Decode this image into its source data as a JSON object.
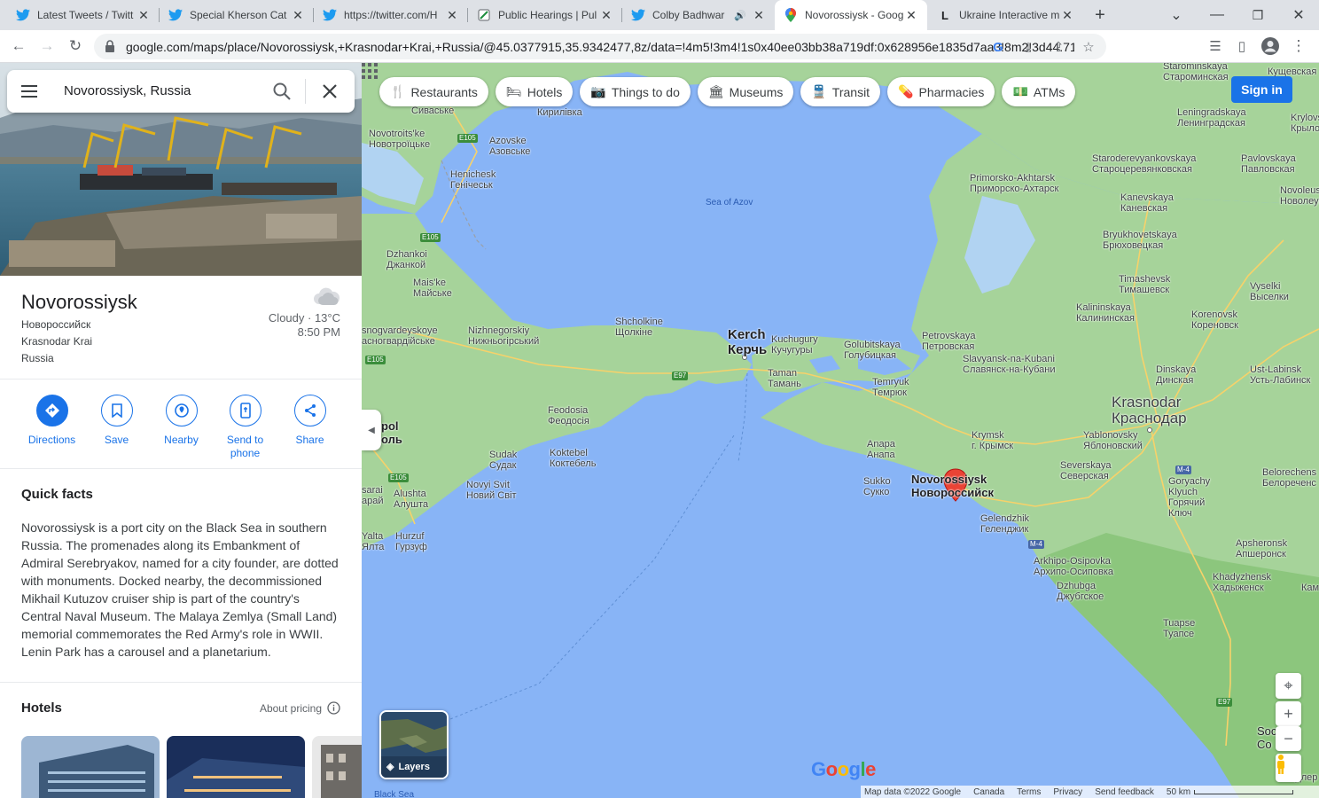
{
  "browser": {
    "tabs": [
      {
        "title": "Latest Tweets / Twitt",
        "icon": "twitter-icon"
      },
      {
        "title": "Special Kherson Cat",
        "icon": "twitter-icon"
      },
      {
        "title": "https://twitter.com/H",
        "icon": "twitter-icon"
      },
      {
        "title": "Public Hearings | Pul",
        "icon": "document-icon"
      },
      {
        "title": "Colby Badhwar",
        "icon": "twitter-icon"
      },
      {
        "title": "Novorossiysk - Goog",
        "icon": "maps-pin-icon"
      },
      {
        "title": "Ukraine Interactive m",
        "icon": "liveuamap-icon"
      }
    ],
    "url": "google.com/maps/place/Novorossiysk,+Krasnodar+Krai,+Russia/@45.0377915,35.9342477,8z/data=!4m5!3m4!1s0x40ee03bb38a719df:0x628956e1835d7aa3!8m2!3d44.718..."
  },
  "search": {
    "query": "Novorossiysk, Russia"
  },
  "place": {
    "name": "Novorossiysk",
    "local_name": "Новороссийск",
    "region": "Krasnodar Krai",
    "country": "Russia",
    "weather": "Cloudy · 13°C",
    "time": "8:50 PM"
  },
  "actions": [
    {
      "label": "Directions",
      "icon": "directions-icon"
    },
    {
      "label": "Save",
      "icon": "bookmark-icon"
    },
    {
      "label": "Nearby",
      "icon": "nearby-icon"
    },
    {
      "label": "Send to phone",
      "icon": "phone-icon"
    },
    {
      "label": "Share",
      "icon": "share-icon"
    }
  ],
  "quick_facts": {
    "heading": "Quick facts",
    "text": "Novorossiysk is a port city on the Black Sea in southern Russia. The promenades along its Embankment of Admiral Serebryakov, named for a city founder, are dotted with monuments. Docked nearby, the decommissioned Mikhail Kutuzov cruiser ship is part of the country's Central Naval Museum. The Malaya Zemlya (Small Land) memorial commemorates the Red Army's role in WWII. Lenin Park has a carousel and a planetarium."
  },
  "hotels": {
    "heading": "Hotels",
    "pricing_label": "About pricing"
  },
  "chips": [
    "Restaurants",
    "Hotels",
    "Things to do",
    "Museums",
    "Transit",
    "Pharmacies",
    "ATMs"
  ],
  "map": {
    "sign_in": "Sign in",
    "layers_label": "Layers",
    "logo": "Google",
    "footer": [
      "Map data ©2022 Google",
      "Canada",
      "Terms",
      "Privacy",
      "Send feedback",
      "50 km"
    ],
    "labels": {
      "sea_azov": "Sea of Azov",
      "black_sea": "Black Sea",
      "kerch": "Kerch",
      "kerch_ru": "Керчь",
      "krasnodar": "Krasnodar",
      "krasnodar_ru": "Краснодар",
      "novo": "Novorossiysk",
      "novo_ru": "Новороссийск",
      "sivaske": "Сиваське",
      "kyrylivka": "Кирилівка",
      "novotroitske": "Novotroits'ke",
      "novotroitske_ru": "Новотроїцьке",
      "azovske": "Azovske",
      "azovske_ru": "Азовське",
      "henichesk": "Henichesk",
      "henichesk_ru": "Генічеськ",
      "dzhankoi": "Dzhankoi",
      "dzhankoi_ru": "Джанкой",
      "maiske": "Mais'ke",
      "maiske_ru": "Майське",
      "snogvardeiskoe": "snogvardeyskoye",
      "snogvardeiskoe_ru": "асногвардійське",
      "nizhnegorsky": "Nizhnegorskiy",
      "nizhnegorsky_ru": "Нижньогірський",
      "shcholkine": "Shcholkine",
      "shcholkine_ru": "Щолкіне",
      "kuchugury": "Kuchugury",
      "kuchugury_ru": "Кучугуры",
      "taman": "Taman",
      "taman_ru": "Тамань",
      "golubitskaya": "Golubitskaya",
      "golubitskaya_ru": "Голубицкая",
      "temryuk": "Temryuk",
      "temryuk_ru": "Темрюк",
      "petrovskaya": "Petrovskaya",
      "petrovskaya_ru": "Петровская",
      "slavyansk": "Slavyansk-na-Kubani",
      "slavyansk_ru": "Славянск-на-Кубани",
      "feodosia": "Feodosia",
      "feodosia_ru": "Феодосія",
      "sudak": "Sudak",
      "sudak_ru": "Судак",
      "koktebel": "Koktebel",
      "koktebel_ru": "Коктебель",
      "novyisvit": "Novyi Svit",
      "novyisvit_ru": "Новий Світ",
      "alushta": "Alushta",
      "alushta_ru": "Алушта",
      "yalta": "Yalta",
      "yalta_ru": "Ялта",
      "hurzuf": "Hurzuf",
      "hurzuf_ru": "Гурзуф",
      "sarai": "sarai",
      "sarai_ru": "арай",
      "pol": "pol",
      "pol_ru": "оль",
      "krymsk": "Krymsk",
      "krymsk_ru": "г. Крымск",
      "anapa": "Anapa",
      "anapa_ru": "Анапа",
      "sukko": "Sukko",
      "sukko_ru": "Сукко",
      "gelendzhik": "Gelendzhik",
      "gelendzhik_ru": "Геленджик",
      "arkhipo": "Arkhipo-Osipovka",
      "arkhipo_ru": "Архипо-Осиповка",
      "dzhubga": "Dzhubga",
      "dzhubga_ru": "Джубгское",
      "tuapse": "Tuapse",
      "tuapse_ru": "Туапсе",
      "severskaya": "Severskaya",
      "severskaya_ru": "Северская",
      "yablonovsky": "Yablonovsky",
      "yablonovsky_ru": "Яблоновский",
      "goryachy": "Goryachy",
      "goryachy2": "Klyuch",
      "goryachy_ru": "Горячий",
      "goryachy_ru2": "Ключ",
      "apsheronsk": "Apsheronsk",
      "apsheronsk_ru": "Апшеронск",
      "khadyzhensk": "Khadyzhensk",
      "khadyzhensk_ru": "Хадыженск",
      "belorechensk": "Belorechens",
      "belorechensk_ru": "Белореченс",
      "dinskaya": "Dinskaya",
      "dinskaya_ru": "Динская",
      "ustlabinsk": "Ust-Labinsk",
      "ustlabinsk_ru": "Усть-Лабинск",
      "korenovsk": "Korenovsk",
      "korenovsk_ru": "Кореновск",
      "vyselki": "Vyselki",
      "vyselki_ru": "Выселки",
      "kalininskaya": "Kalininskaya",
      "kalininskaya_ru": "Калининская",
      "timashevsk": "Timashevsk",
      "timashevsk_ru": "Тимашевск",
      "bryukhovetskaya": "Bryukhovetskaya",
      "bryukhovetskaya_ru": "Брюховецкая",
      "kanevskaya": "Kanevskaya",
      "kanevskaya_ru": "Каневская",
      "primorsko": "Primorsko-Akhtarsk",
      "primorsko_ru": "Приморско-Ахтарск",
      "staroderevyankovskaya": "Staroderevyankovskaya",
      "staroderevyankovskaya_ru": "Староцеревянковская",
      "pavlovskaya": "Pavlovskaya",
      "pavlovskaya_ru": "Павловская",
      "leningradskaya": "Leningradskaya",
      "leningradskaya_ru": "Ленинградская",
      "starominskaya": "Starominskaya",
      "starominskaya_ru": "Староминская",
      "kushchevskaya": "Кущевская",
      "krylovskaya": "Krylovs",
      "krylovskaya_ru": "Крылов",
      "novoleushk": "Novoleushk",
      "novoleushk_ru": "Новолеуш",
      "soch": "Soc",
      "soch_ru": "Со",
      "adler": "Адлер",
      "kam": "Кам",
      "e105": "E105",
      "e97": "E97",
      "m4": "M-4"
    }
  }
}
